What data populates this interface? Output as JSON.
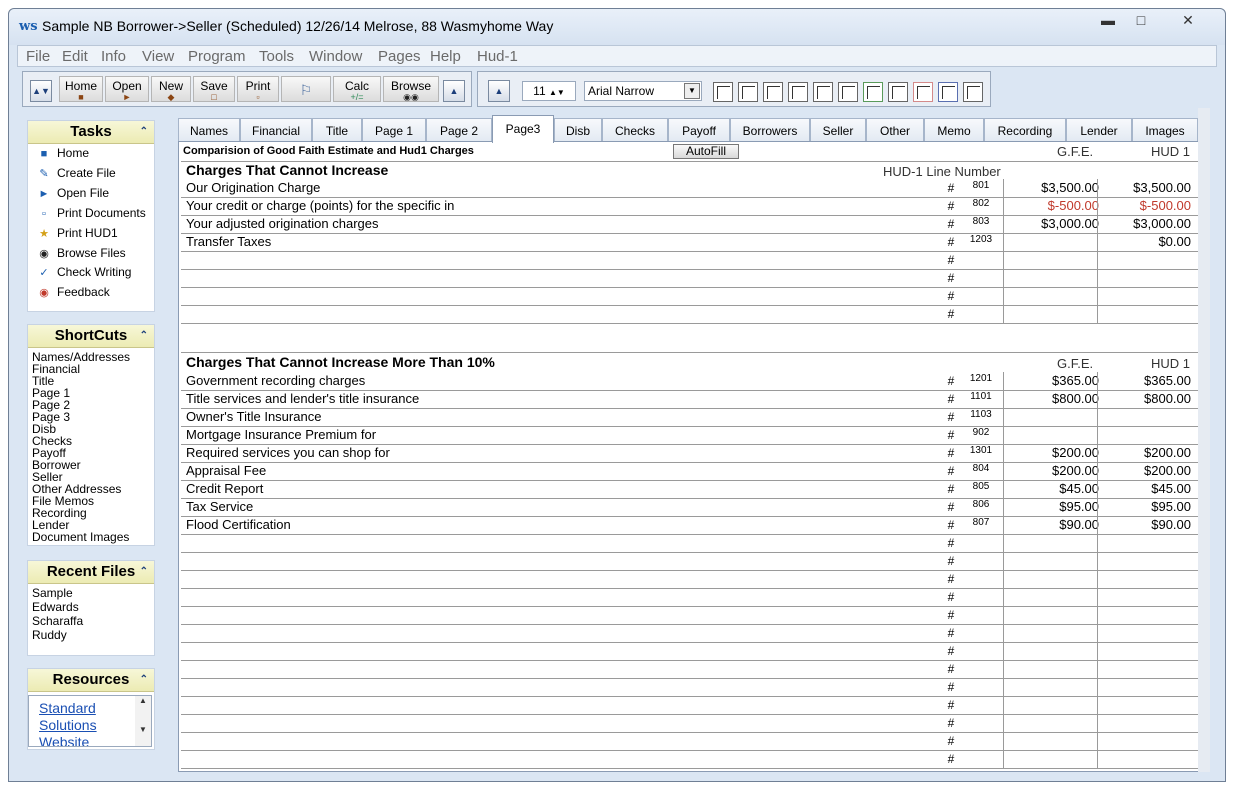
{
  "window": {
    "title": "Sample NB Borrower->Seller (Scheduled) 12/26/14 Melrose, 88 Wasmyhome Way",
    "app_icon": "ws-logo-icon"
  },
  "menu": [
    "File",
    "Edit",
    "Info",
    "View",
    "Program",
    "Tools",
    "Window",
    "Pages",
    "Help",
    "Hud-1"
  ],
  "toolbar": {
    "home": "Home",
    "open": "Open",
    "new": "New",
    "save": "Save",
    "print": "Print",
    "calc": "Calc",
    "calc_sub": "+/=",
    "browse": "Browse",
    "font_size": "11",
    "font_name": "Arial Narrow"
  },
  "sidebar": {
    "tasks_title": "Tasks",
    "tasks": [
      {
        "label": "Home",
        "icon": "home-icon"
      },
      {
        "label": "Create File",
        "icon": "create-file-icon"
      },
      {
        "label": "Open File",
        "icon": "open-file-icon"
      },
      {
        "label": "Print Documents",
        "icon": "print-documents-icon"
      },
      {
        "label": "Print HUD1",
        "icon": "print-hud1-icon"
      },
      {
        "label": "Browse Files",
        "icon": "binoculars-icon"
      },
      {
        "label": "Check Writing",
        "icon": "check-writing-icon"
      },
      {
        "label": "Feedback",
        "icon": "feedback-icon"
      }
    ],
    "shortcuts_title": "ShortCuts",
    "shortcuts": [
      "Names/Addresses",
      "Financial",
      "Title",
      "Page 1",
      "Page 2",
      "Page 3",
      "Disb",
      "Checks",
      "Payoff",
      "Borrower",
      "Seller",
      "Other Addresses",
      "File Memos",
      "Recording",
      "Lender",
      "Document Images"
    ],
    "recent_title": "Recent Files",
    "recent": [
      "Sample",
      "Edwards",
      "Scharaffa",
      "Ruddy"
    ],
    "resources_title": "Resources",
    "resources": [
      "Standard",
      "Solutions",
      "Website"
    ]
  },
  "tabs": [
    "Names",
    "Financial",
    "Title",
    "Page 1",
    "Page 2",
    "Page3",
    "Disb",
    "Checks",
    "Payoff",
    "Borrowers",
    "Seller",
    "Other",
    "Memo",
    "Recording",
    "Lender",
    "Images"
  ],
  "active_tab": "Page3",
  "sheet": {
    "heading": "Comparision of Good Faith Estimate and Hud1 Charges",
    "autofill": "AutoFill",
    "gfe_label": "G.F.E.",
    "hud_label": "HUD 1",
    "section1_title": "Charges That Cannot Increase",
    "hud_line_label": "HUD-1 Line Number",
    "section2_title": "Charges That Cannot Increase More Than 10%",
    "hash": "#",
    "section1_rows": [
      {
        "desc": "Our Origination Charge",
        "line": "801",
        "gfe": "$3,500.00",
        "hud": "$3,500.00",
        "red": false
      },
      {
        "desc": "Your credit or charge (points) for the specific in",
        "line": "802",
        "gfe": "$-500.00",
        "hud": "$-500.00",
        "red": true
      },
      {
        "desc": "Your adjusted origination charges",
        "line": "803",
        "gfe": "$3,000.00",
        "hud": "$3,000.00",
        "red": false
      },
      {
        "desc": "Transfer Taxes",
        "line": "1203",
        "gfe": "",
        "hud": "$0.00",
        "red": false
      },
      {
        "desc": "",
        "line": "",
        "gfe": "",
        "hud": "",
        "red": false
      },
      {
        "desc": "",
        "line": "",
        "gfe": "",
        "hud": "",
        "red": false
      },
      {
        "desc": "",
        "line": "",
        "gfe": "",
        "hud": "",
        "red": false
      },
      {
        "desc": "",
        "line": "",
        "gfe": "",
        "hud": "",
        "red": false
      }
    ],
    "section2_rows": [
      {
        "desc": "Government recording charges",
        "line": "1201",
        "gfe": "$365.00",
        "hud": "$365.00"
      },
      {
        "desc": "Title services and lender's title insurance",
        "line": "1101",
        "gfe": "$800.00",
        "hud": "$800.00"
      },
      {
        "desc": "Owner's Title Insurance",
        "line": "1103",
        "gfe": "",
        "hud": ""
      },
      {
        "desc": "Mortgage Insurance Premium for",
        "line": "902",
        "gfe": "",
        "hud": ""
      },
      {
        "desc": "Required services you can shop for",
        "line": "1301",
        "gfe": "$200.00",
        "hud": "$200.00"
      },
      {
        "desc": "Appraisal Fee",
        "line": "804",
        "gfe": "$200.00",
        "hud": "$200.00"
      },
      {
        "desc": "Credit Report",
        "line": "805",
        "gfe": "$45.00",
        "hud": "$45.00"
      },
      {
        "desc": "Tax Service",
        "line": "806",
        "gfe": "$95.00",
        "hud": "$95.00"
      },
      {
        "desc": "Flood Certification",
        "line": "807",
        "gfe": "$90.00",
        "hud": "$90.00"
      },
      {
        "desc": "",
        "line": "",
        "gfe": "",
        "hud": ""
      },
      {
        "desc": "",
        "line": "",
        "gfe": "",
        "hud": ""
      },
      {
        "desc": "",
        "line": "",
        "gfe": "",
        "hud": ""
      },
      {
        "desc": "",
        "line": "",
        "gfe": "",
        "hud": ""
      },
      {
        "desc": "",
        "line": "",
        "gfe": "",
        "hud": ""
      },
      {
        "desc": "",
        "line": "",
        "gfe": "",
        "hud": ""
      },
      {
        "desc": "",
        "line": "",
        "gfe": "",
        "hud": ""
      },
      {
        "desc": "",
        "line": "",
        "gfe": "",
        "hud": ""
      },
      {
        "desc": "",
        "line": "",
        "gfe": "",
        "hud": ""
      },
      {
        "desc": "",
        "line": "",
        "gfe": "",
        "hud": ""
      },
      {
        "desc": "",
        "line": "",
        "gfe": "",
        "hud": ""
      },
      {
        "desc": "",
        "line": "",
        "gfe": "",
        "hud": ""
      },
      {
        "desc": "",
        "line": "",
        "gfe": "",
        "hud": ""
      }
    ]
  },
  "colors": {
    "window_bg": "#dbe6f3",
    "panel_head": "#ecebb3",
    "negative": "#c0392b",
    "link": "#1a4fb3"
  }
}
